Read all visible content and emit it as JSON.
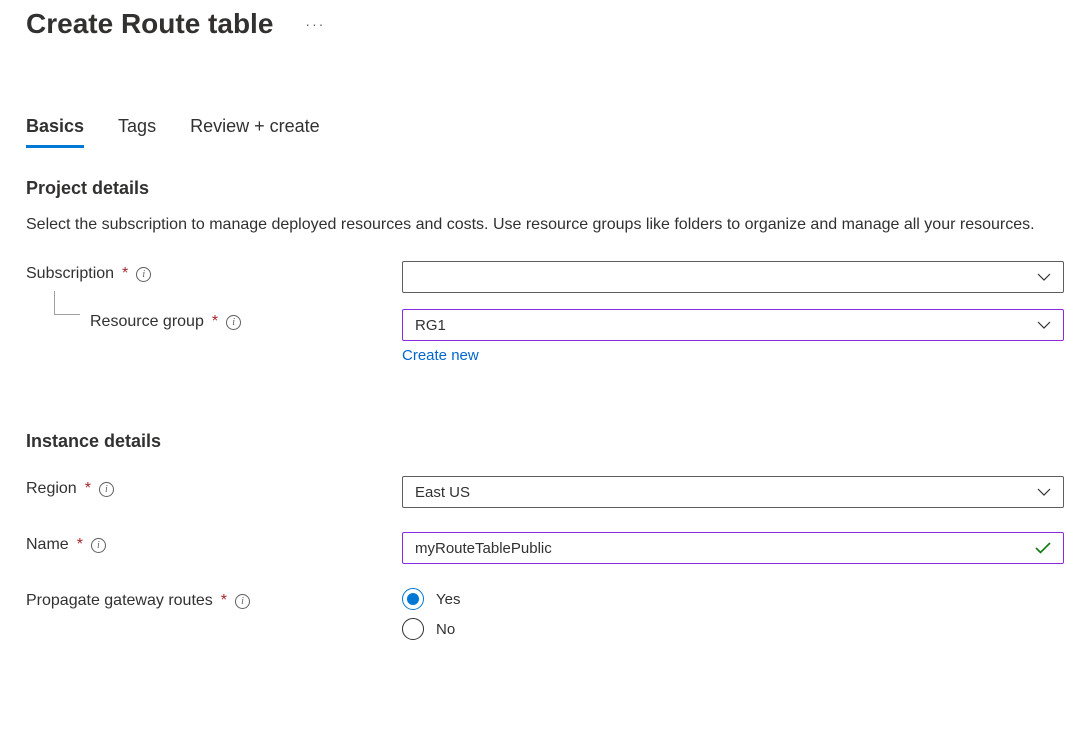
{
  "header": {
    "title": "Create Route table"
  },
  "tabs": [
    {
      "label": "Basics",
      "active": true
    },
    {
      "label": "Tags",
      "active": false
    },
    {
      "label": "Review + create",
      "active": false
    }
  ],
  "project_details": {
    "heading": "Project details",
    "description": "Select the subscription to manage deployed resources and costs. Use resource groups like folders to organize and manage all your resources.",
    "subscription_label": "Subscription",
    "subscription_value": "",
    "resource_group_label": "Resource group",
    "resource_group_value": "RG1",
    "create_new_label": "Create new"
  },
  "instance_details": {
    "heading": "Instance details",
    "region_label": "Region",
    "region_value": "East US",
    "name_label": "Name",
    "name_value": "myRouteTablePublic",
    "propagate_label": "Propagate gateway routes",
    "propagate_options": {
      "yes": "Yes",
      "no": "No"
    },
    "propagate_selected": "yes"
  }
}
